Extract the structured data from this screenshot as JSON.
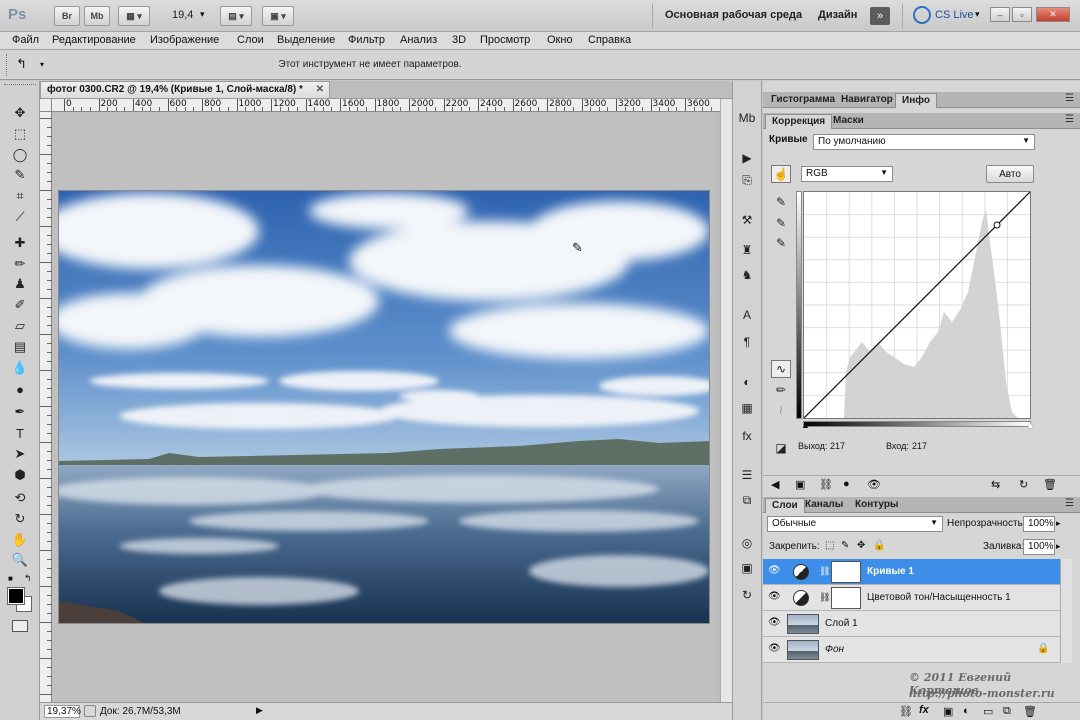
{
  "appbar": {
    "logo": "Ps",
    "buttons": [
      "Br",
      "Mb"
    ],
    "zoom": "19,4",
    "workspace_main": "Основная рабочая среда",
    "workspace_design": "Дизайн",
    "cs_live": "CS Live",
    "chevron": "»"
  },
  "menu": [
    "Файл",
    "Редактирование",
    "Изображение",
    "Слои",
    "Выделение",
    "Фильтр",
    "Анализ",
    "3D",
    "Просмотр",
    "Окно",
    "Справка"
  ],
  "options_bar": {
    "message": "Этот инструмент не имеет параметров."
  },
  "document": {
    "tab_title": "фотог 0300.CR2 @ 19,4% (Кривые 1, Слой-маска/8) *",
    "ruler_labels": [
      "0",
      "200",
      "400",
      "600",
      "800",
      "1000",
      "1200",
      "1400",
      "1600",
      "1800",
      "2000",
      "2200",
      "2400",
      "2600",
      "2800",
      "3000",
      "3200",
      "3400",
      "3600"
    ]
  },
  "status": {
    "zoom": "19,37%",
    "doc": "Док: 26,7M/53,3M"
  },
  "panels": {
    "top_tabs": [
      "Гистограмма",
      "Навигатор",
      "Инфо"
    ],
    "mid_tabs": [
      "Коррекция",
      "Маски"
    ],
    "curves": {
      "label": "Кривые",
      "preset": "По умолчанию",
      "channel": "RGB",
      "auto_button": "Авто",
      "output_label": "Выход:",
      "output_value": "217",
      "input_label": "Вход:",
      "input_value": "217"
    },
    "layers_tabs": [
      "Слои",
      "Каналы",
      "Контуры"
    ],
    "blend_mode": "Обычные",
    "opacity_label": "Непрозрачность:",
    "opacity_value": "100%",
    "lock_label": "Закрепить:",
    "fill_label": "Заливка:",
    "fill_value": "100%",
    "layers": [
      {
        "name": "Кривые 1",
        "type": "adjustment",
        "active": true
      },
      {
        "name": "Цветовой тон/Насыщенность 1",
        "type": "adjustment",
        "active": false
      },
      {
        "name": "Слой 1",
        "type": "image",
        "active": false
      },
      {
        "name": "Фон",
        "type": "image",
        "active": false,
        "italic": true
      }
    ]
  },
  "watermark": {
    "line1": "© 2011 Евгений Карташов",
    "line2": "http://photo-monster.ru"
  }
}
